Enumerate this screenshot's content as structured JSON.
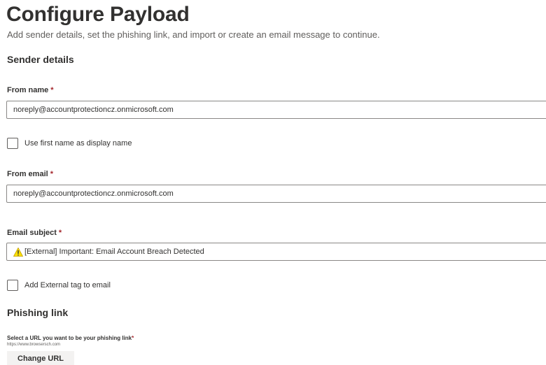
{
  "header": {
    "title": "Configure Payload",
    "subtitle": "Add sender details, set the phishing link, and import or create an email message to continue."
  },
  "sender_details": {
    "heading": "Sender details",
    "from_name": {
      "label": "From name",
      "required_marker": "*",
      "value": "noreply@accountprotectioncz.onmicrosoft.com"
    },
    "use_first_name": {
      "label": "Use first name as display name",
      "checked": false
    },
    "from_email": {
      "label": "From email",
      "required_marker": "*",
      "value": "noreply@accountprotectioncz.onmicrosoft.com"
    },
    "email_subject": {
      "label": "Email subject",
      "required_marker": "*",
      "icon": "warning-icon",
      "value": "[External] Important: Email Account Breach Detected"
    },
    "add_external_tag": {
      "label": "Add External tag to email",
      "checked": false
    }
  },
  "phishing_link": {
    "heading": "Phishing link",
    "select_label": "Select a URL you want to be your phishing link",
    "required_marker": "*",
    "url": "https://www.browsersch.com",
    "change_button_label": "Change URL"
  },
  "colors": {
    "required": "#a4262c",
    "warning_fill": "#fce100",
    "border": "#8a8886",
    "button_bg": "#f3f2f1"
  }
}
